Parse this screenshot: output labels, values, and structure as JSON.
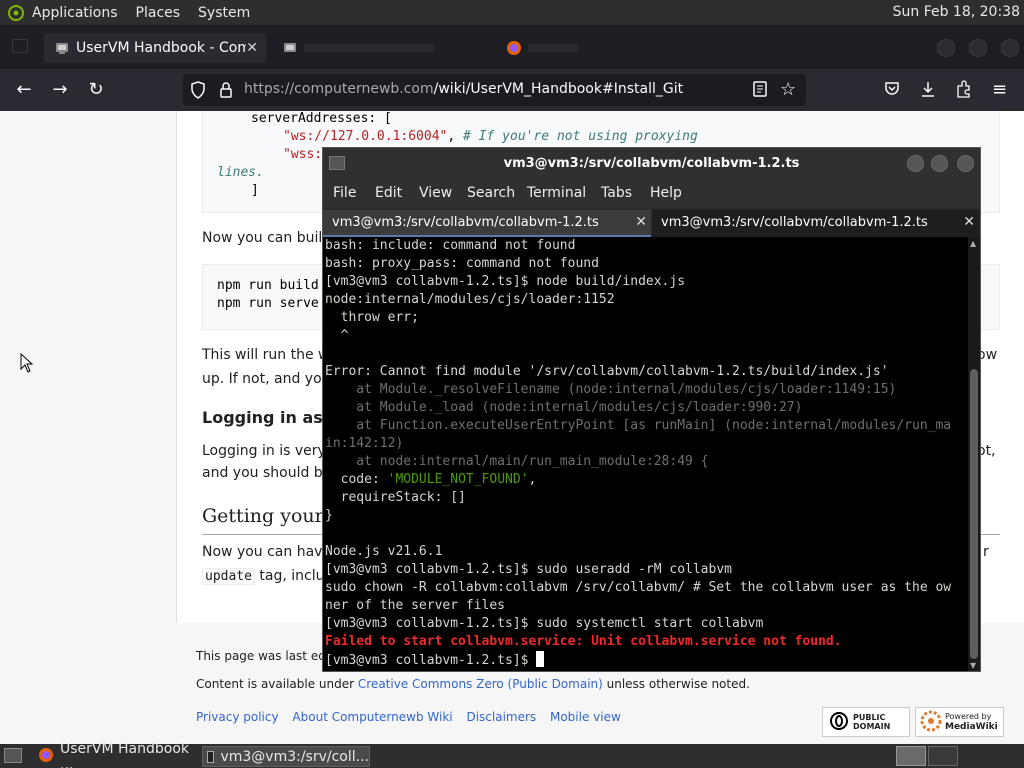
{
  "top_panel": {
    "menus": [
      "Applications",
      "Places",
      "System"
    ],
    "clock": "Sun Feb 18, 20:38"
  },
  "firefox": {
    "active_tab_title": "UserVM Handbook - Compu",
    "inactive_tab_2": "",
    "inactive_tab_3": "",
    "url_host": "https://computernewb.com",
    "url_path": "/wiki/UserVM_Handbook#Install_Git"
  },
  "page": {
    "code1": {
      "line1_key": "serverAddresses: [",
      "line2_str": "\"ws://127.0.0.1:6004\"",
      "line2_comment": "# If you're not using proxying",
      "line3_str": "\"wss:",
      "line4_tail": "lines.",
      "line5": "]"
    },
    "para_build": "Now you can build t",
    "code2": {
      "line1": "npm run build",
      "line2": "npm run serve"
    },
    "para_run_1": "This will run the web",
    "para_run_1_tail": "ow",
    "para_run_2": "up. If not, and you c",
    "heading_login": "Logging in as a",
    "para_login_1": "Logging in is very s",
    "para_login_1_tail": "ot,",
    "para_login_2": "and you should be a",
    "heading_getting": "Getting your U",
    "para_getting_1": "Now you can have y",
    "para_getting_1_tail": "r",
    "para_getting_2_code": "update",
    "para_getting_2_text": " tag, incluc",
    "footer": {
      "last_edited": "This page was last edite",
      "content_prefix": "Content is available under ",
      "content_link": "Creative Commons Zero (Public Domain)",
      "content_suffix": " unless otherwise noted.",
      "links": [
        "Privacy policy",
        "About Computernewb Wiki",
        "Disclaimers",
        "Mobile view"
      ],
      "badge_public_domain": "PUBLIC DOMAIN",
      "badge_mediawiki_1": "Powered by",
      "badge_mediawiki_2": "MediaWiki"
    }
  },
  "terminal": {
    "title": "vm3@vm3:/srv/collabvm/collabvm-1.2.ts",
    "menu": [
      "File",
      "Edit",
      "View",
      "Search",
      "Terminal",
      "Tabs",
      "Help"
    ],
    "tabs": [
      "vm3@vm3:/srv/collabvm/collabvm-1.2.ts",
      "vm3@vm3:/srv/collabvm/collabvm-1.2.ts"
    ],
    "lines": [
      {
        "text": "bash: include: command not found",
        "style": ""
      },
      {
        "text": "bash: proxy_pass: command not found",
        "style": ""
      },
      {
        "text": "[vm3@vm3 collabvm-1.2.ts]$ node build/index.js",
        "style": ""
      },
      {
        "text": "node:internal/modules/cjs/loader:1152",
        "style": ""
      },
      {
        "text": "  throw err;",
        "style": ""
      },
      {
        "text": "  ^",
        "style": ""
      },
      {
        "text": "",
        "style": ""
      },
      {
        "text": "Error: Cannot find module '/srv/collabvm/collabvm-1.2.ts/build/index.js'",
        "style": ""
      },
      {
        "text": "    at Module._resolveFilename (node:internal/modules/cjs/loader:1149:15)",
        "style": "grey"
      },
      {
        "text": "    at Module._load (node:internal/modules/cjs/loader:990:27)",
        "style": "grey"
      },
      {
        "text": "    at Function.executeUserEntryPoint [as runMain] (node:internal/modules/run_ma",
        "style": "grey"
      },
      {
        "text": "in:142:12)",
        "style": "grey"
      },
      {
        "text": "    at node:internal/main/run_main_module:28:49 {",
        "style": "grey"
      },
      {
        "text": "  code: 'MODULE_NOT_FOUND',",
        "style": "code"
      },
      {
        "text": "  requireStack: []",
        "style": ""
      },
      {
        "text": "}",
        "style": ""
      },
      {
        "text": "",
        "style": ""
      },
      {
        "text": "Node.js v21.6.1",
        "style": ""
      },
      {
        "text": "[vm3@vm3 collabvm-1.2.ts]$ sudo useradd -rM collabvm",
        "style": ""
      },
      {
        "text": "sudo chown -R collabvm:collabvm /srv/collabvm/ # Set the collabvm user as the ow",
        "style": ""
      },
      {
        "text": "ner of the server files",
        "style": ""
      },
      {
        "text": "[vm3@vm3 collabvm-1.2.ts]$ sudo systemctl start collabvm",
        "style": ""
      },
      {
        "text": "Failed to start collabvm.service: Unit collabvm.service not found.",
        "style": "red"
      },
      {
        "text": "[vm3@vm3 collabvm-1.2.ts]$ ",
        "style": "prompt"
      }
    ],
    "code_line_key": "  code: ",
    "code_line_value": "'MODULE_NOT_FOUND'",
    "code_line_tail": ","
  },
  "taskbar": {
    "firefox_task": "UserVM Handbook ...",
    "terminal_task": "vm3@vm3:/srv/coll..."
  },
  "colors": {
    "panel_bg": "#2e2e30",
    "terminal_bg": "#000000",
    "error_red": "#ef2929",
    "link_blue": "#3366cc"
  }
}
